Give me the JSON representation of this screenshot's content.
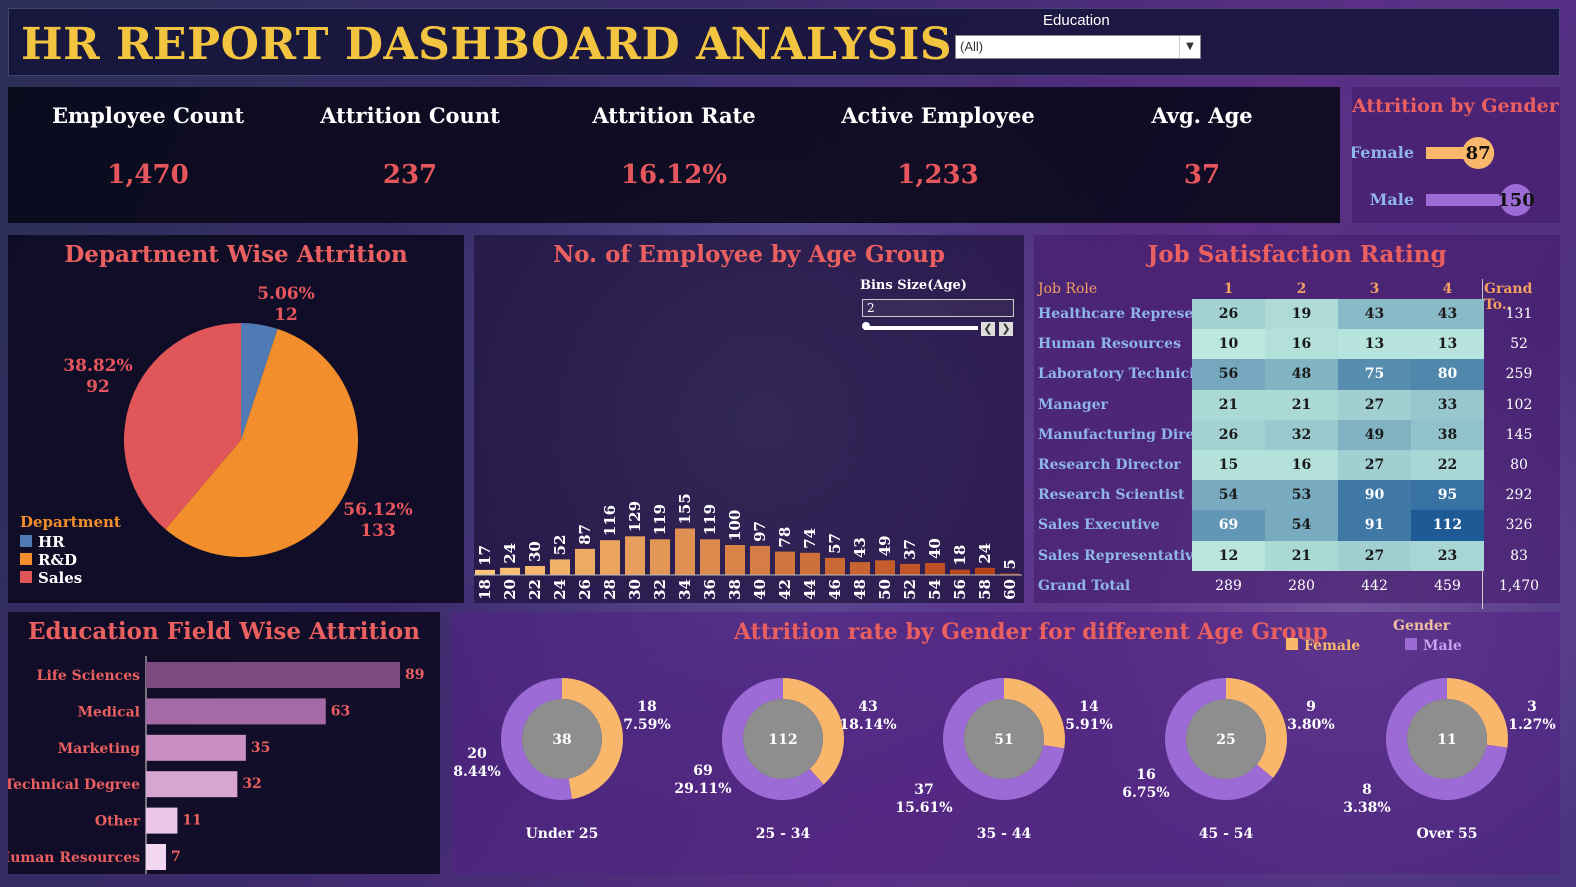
{
  "header": {
    "title": "HR REPORT DASHBOARD ANALYSIS",
    "filter_label": "Education",
    "filter_value": "(All)"
  },
  "kpis": [
    {
      "label": "Employee Count",
      "value": "1,470"
    },
    {
      "label": "Attrition Count",
      "value": "237"
    },
    {
      "label": "Attrition Rate",
      "value": "16.12%"
    },
    {
      "label": "Active Employee",
      "value": "1,233"
    },
    {
      "label": "Avg. Age",
      "value": "37"
    }
  ],
  "gender_attrition": {
    "title": "Attrition by Gender",
    "rows": [
      {
        "label": "Female",
        "value": 87,
        "color": "#f9b76b"
      },
      {
        "label": "Male",
        "value": 150,
        "color": "#9c6bd6"
      }
    ]
  },
  "department": {
    "title": "Department Wise Attrition",
    "legend_title": "Department",
    "slices": [
      {
        "name": "HR",
        "pct": "5.06%",
        "count": "12",
        "value": 12,
        "color": "#4f7ab3"
      },
      {
        "name": "R&D",
        "pct": "56.12%",
        "count": "133",
        "value": 133,
        "color": "#f28e2b"
      },
      {
        "name": "Sales",
        "pct": "38.82%",
        "count": "92",
        "value": 92,
        "color": "#e15759"
      }
    ]
  },
  "age_group": {
    "title": "No. of Employee by Age Group",
    "bins_label": "Bins Size(Age)",
    "bins_value": "2"
  },
  "job_satisfaction": {
    "title": "Job Satisfaction Rating",
    "header": [
      "Job Role",
      "1",
      "2",
      "3",
      "4",
      "Grand To.."
    ],
    "rows": [
      {
        "role": "Healthcare Represen..",
        "vals": [
          26,
          19,
          43,
          43
        ],
        "total": "131"
      },
      {
        "role": "Human Resources",
        "vals": [
          10,
          16,
          13,
          13
        ],
        "total": "52"
      },
      {
        "role": "Laboratory Technicia..",
        "vals": [
          56,
          48,
          75,
          80
        ],
        "total": "259"
      },
      {
        "role": "Manager",
        "vals": [
          21,
          21,
          27,
          33
        ],
        "total": "102"
      },
      {
        "role": "Manufacturing Direct..",
        "vals": [
          26,
          32,
          49,
          38
        ],
        "total": "145"
      },
      {
        "role": "Research Director",
        "vals": [
          15,
          16,
          27,
          22
        ],
        "total": "80"
      },
      {
        "role": "Research Scientist",
        "vals": [
          54,
          53,
          90,
          95
        ],
        "total": "292"
      },
      {
        "role": "Sales Executive",
        "vals": [
          69,
          54,
          91,
          112
        ],
        "total": "326"
      },
      {
        "role": "Sales Representative",
        "vals": [
          12,
          21,
          27,
          23
        ],
        "total": "83"
      }
    ],
    "grand_total": {
      "label": "Grand Total",
      "vals": [
        "289",
        "280",
        "442",
        "459"
      ],
      "total": "1,470"
    }
  },
  "education": {
    "title": "Education Field Wise Attrition",
    "items": [
      {
        "label": "Life Sciences",
        "value": 89,
        "color": "#7c4a7e"
      },
      {
        "label": "Medical",
        "value": 63,
        "color": "#a46aa6"
      },
      {
        "label": "Marketing",
        "value": 35,
        "color": "#c98fc4"
      },
      {
        "label": "Technical Degree",
        "value": 32,
        "color": "#d8a4d2"
      },
      {
        "label": "Other",
        "value": 11,
        "color": "#ecc7e8"
      },
      {
        "label": "Human Resources",
        "value": 7,
        "color": "#f3d6ef"
      }
    ]
  },
  "donuts": {
    "title": "Attrition rate by Gender for different Age Group",
    "legend_title": "Gender",
    "legend": [
      {
        "label": "Female",
        "color": "#f9b76b"
      },
      {
        "label": "Male",
        "color": "#9c6bd6"
      }
    ],
    "groups": [
      {
        "label": "Under 25",
        "center": "38",
        "female_count": "18",
        "female_pct": "7.59%",
        "male_count": "20",
        "male_pct": "8.44%",
        "female": 18,
        "male": 20
      },
      {
        "label": "25 - 34",
        "center": "112",
        "female_count": "43",
        "female_pct": "18.14%",
        "male_count": "69",
        "male_pct": "29.11%",
        "female": 43,
        "male": 69
      },
      {
        "label": "35 - 44",
        "center": "51",
        "female_count": "14",
        "female_pct": "5.91%",
        "male_count": "37",
        "male_pct": "15.61%",
        "female": 14,
        "male": 37
      },
      {
        "label": "45 - 54",
        "center": "25",
        "female_count": "9",
        "female_pct": "3.80%",
        "male_count": "16",
        "male_pct": "6.75%",
        "female": 9,
        "male": 16
      },
      {
        "label": "Over 55",
        "center": "11",
        "female_count": "3",
        "female_pct": "1.27%",
        "male_count": "8",
        "male_pct": "3.38%",
        "female": 3,
        "male": 8
      }
    ]
  },
  "chart_data": [
    {
      "type": "pie",
      "title": "Department Wise Attrition",
      "categories": [
        "HR",
        "R&D",
        "Sales"
      ],
      "values": [
        12,
        133,
        92
      ]
    },
    {
      "type": "bar",
      "title": "No. of Employee by Age Group",
      "categories": [
        "18",
        "20",
        "22",
        "24",
        "26",
        "28",
        "30",
        "32",
        "34",
        "36",
        "38",
        "40",
        "42",
        "44",
        "46",
        "48",
        "50",
        "52",
        "54",
        "56",
        "58",
        "60"
      ],
      "values": [
        17,
        24,
        30,
        52,
        87,
        116,
        129,
        119,
        155,
        119,
        100,
        97,
        78,
        74,
        57,
        43,
        49,
        37,
        40,
        18,
        24,
        5
      ]
    },
    {
      "type": "bar",
      "title": "Education Field Wise Attrition",
      "categories": [
        "Life Sciences",
        "Medical",
        "Marketing",
        "Technical Degree",
        "Other",
        "Human Resources"
      ],
      "values": [
        89,
        63,
        35,
        32,
        11,
        7
      ]
    },
    {
      "type": "bar",
      "title": "Attrition by Gender",
      "categories": [
        "Female",
        "Male"
      ],
      "values": [
        87,
        150
      ]
    },
    {
      "type": "pie",
      "title": "Attrition rate by Gender for different Age Group",
      "categories": [
        "Under 25",
        "25 - 34",
        "35 - 44",
        "45 - 54",
        "Over 55"
      ],
      "series": [
        {
          "name": "Female",
          "values": [
            18,
            43,
            14,
            9,
            3
          ]
        },
        {
          "name": "Male",
          "values": [
            20,
            69,
            37,
            16,
            8
          ]
        }
      ]
    }
  ]
}
